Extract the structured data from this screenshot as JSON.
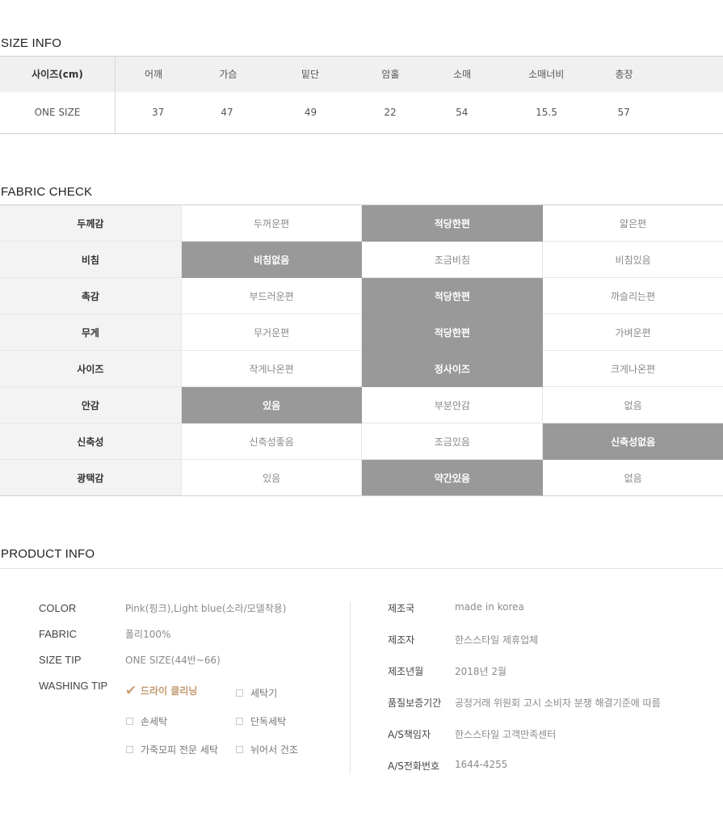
{
  "size_info": {
    "title": "SIZE INFO",
    "header_label": "사이즈(cm)",
    "columns": [
      "어깨",
      "가슴",
      "밑단",
      "암홀",
      "소매",
      "소매너비",
      "총장"
    ],
    "row_label": "ONE SIZE",
    "values": [
      "37",
      "47",
      "49",
      "22",
      "54",
      "15.5",
      "57"
    ]
  },
  "fabric_check": {
    "title": "FABRIC CHECK",
    "rows": [
      {
        "label": "두께감",
        "options": [
          "두꺼운편",
          "적당한편",
          "얇은편"
        ],
        "selected": 1
      },
      {
        "label": "비침",
        "options": [
          "비침없음",
          "조금비침",
          "비침있음"
        ],
        "selected": 0
      },
      {
        "label": "촉감",
        "options": [
          "부드러운편",
          "적당한편",
          "까슬리는편"
        ],
        "selected": 1
      },
      {
        "label": "무게",
        "options": [
          "무거운편",
          "적당한편",
          "가벼운편"
        ],
        "selected": 1
      },
      {
        "label": "사이즈",
        "options": [
          "작게나온편",
          "정사이즈",
          "크게나온편"
        ],
        "selected": 1
      },
      {
        "label": "안감",
        "options": [
          "있음",
          "부분안감",
          "없음"
        ],
        "selected": 0
      },
      {
        "label": "신축성",
        "options": [
          "신축성좋음",
          "조금있음",
          "신축성없음"
        ],
        "selected": 2
      },
      {
        "label": "광택감",
        "options": [
          "있음",
          "약간있음",
          "없음"
        ],
        "selected": 1
      }
    ]
  },
  "product_info": {
    "title": "PRODUCT INFO",
    "color_label": "COLOR",
    "color_value": "Pink(핑크),Light blue(소라/모델착용)",
    "fabric_label": "FABRIC",
    "fabric_value": "폴리100%",
    "size_tip_label": "SIZE TIP",
    "size_tip_value": "ONE SIZE(44반~66)",
    "washing_tip_label": "WASHING TIP",
    "washing": {
      "dry_cleaning": "드라이 클리닝",
      "washing_machine": "세탁기",
      "hand_wash": "손세탁",
      "separate_wash": "단독세탁",
      "leather_fur": "가죽모피 전문 세탁",
      "flat_dry": "뉘어서 건조",
      "checked": "dry_cleaning"
    },
    "details": {
      "origin_label": "제조국",
      "origin_value": "made in korea",
      "maker_label": "제조자",
      "maker_value": "한스스타일 제휴업체",
      "date_label": "제조년월",
      "date_value": "2018년 2월",
      "warranty_label": "품질보증기간",
      "warranty_value": "공정거래 위원회 고시 소비자 분쟁 해결기준에 따름",
      "as_manager_label": "A/S책임자",
      "as_manager_value": "한스스타일 고객만족센터",
      "as_phone_label": "A/S전화번호",
      "as_phone_value": "1644-4255"
    }
  },
  "colors": {
    "selected_cell": "#999999",
    "label_bg": "#f3f3f3",
    "header_bg": "#f0f0f0",
    "check_accent": "#c39a70"
  }
}
